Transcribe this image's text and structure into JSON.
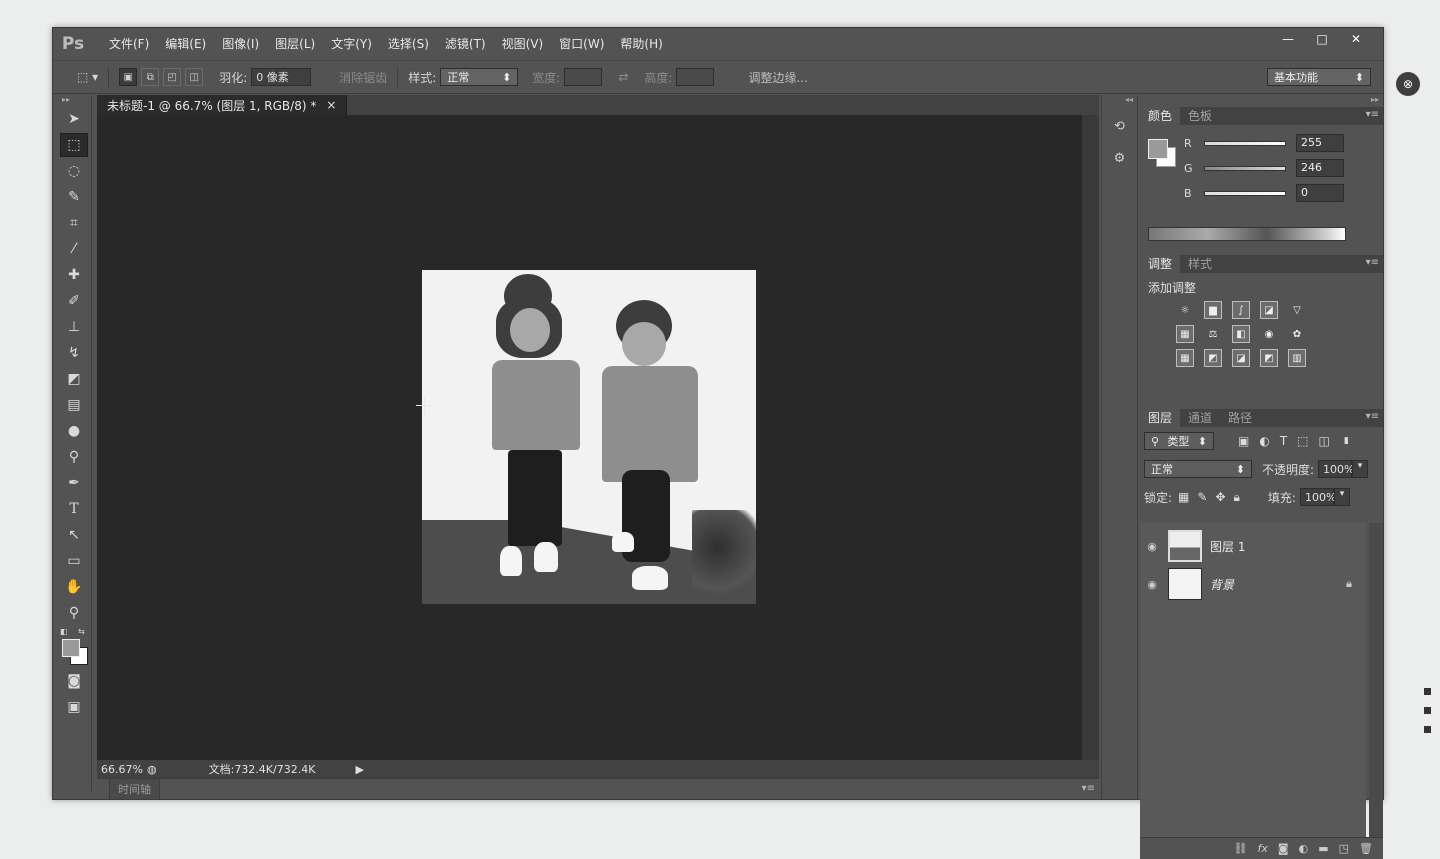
{
  "app": {
    "logo": "Ps"
  },
  "menu": [
    "文件(F)",
    "编辑(E)",
    "图像(I)",
    "图层(L)",
    "文字(Y)",
    "选择(S)",
    "滤镜(T)",
    "视图(V)",
    "窗口(W)",
    "帮助(H)"
  ],
  "window_controls": {
    "minimize": "—",
    "maximize": "□",
    "close": "✕"
  },
  "options": {
    "feather_label": "羽化:",
    "feather_value": "0 像素",
    "antialias": "消除锯齿",
    "style_label": "样式:",
    "style_value": "正常",
    "width_label": "宽度:",
    "height_label": "高度:",
    "refine_edge": "调整边缘...",
    "workspace": "基本功能"
  },
  "document": {
    "tab_title": "未标题-1 @ 66.7% (图层 1, RGB/8) *",
    "close": "×"
  },
  "status": {
    "zoom": "66.67%",
    "doc_info": "文档:732.4K/732.4K",
    "arrow": "▶"
  },
  "timeline": {
    "tab": "时间轴"
  },
  "color_panel": {
    "tabs": [
      "颜色",
      "色板"
    ],
    "channels": [
      {
        "label": "R",
        "value": "255"
      },
      {
        "label": "G",
        "value": "246"
      },
      {
        "label": "B",
        "value": "0"
      }
    ]
  },
  "adjust_panel": {
    "tabs": [
      "调整",
      "样式"
    ],
    "title": "添加调整"
  },
  "layers_panel": {
    "tabs": [
      "图层",
      "通道",
      "路径"
    ],
    "filter_kind": "类型",
    "blend_mode": "正常",
    "opacity_label": "不透明度:",
    "opacity_value": "100%",
    "lock_label": "锁定:",
    "fill_label": "填充:",
    "fill_value": "100%",
    "layers": [
      {
        "name": "图层 1"
      },
      {
        "name": "背景"
      }
    ],
    "footer_icons": [
      "link-icon",
      "fx-icon",
      "mask-icon",
      "adjustment-icon",
      "folder-icon",
      "new-layer-icon",
      "trash-icon"
    ],
    "footer_fx": "fx"
  }
}
